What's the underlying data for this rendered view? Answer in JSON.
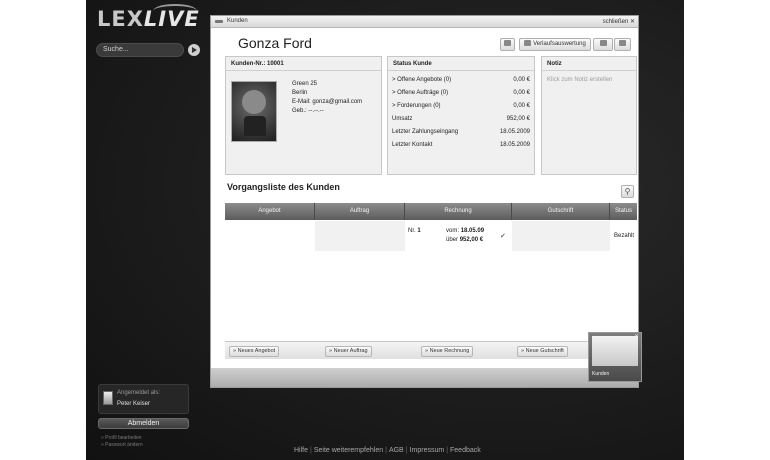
{
  "logo": {
    "prefix": "LEX",
    "suffix": "LIVE"
  },
  "sidebar": {
    "search_placeholder": "Suche...",
    "logged_in_label": "Angemeldet als:",
    "user_name": "Peter Keiser",
    "logout_label": "Abmelden",
    "links": [
      "Profil bearbeiten",
      "Passwort ändern"
    ]
  },
  "footer": {
    "links": [
      "Hilfe",
      "Seite weiterempfehlen",
      "AGB",
      "Impressum",
      "Feedback"
    ]
  },
  "window": {
    "title": "Kunden",
    "close_label": "schließen",
    "customer_name": "Gonza Ford",
    "toolbar": {
      "history_label": "Verlaufsauswertung"
    }
  },
  "customer": {
    "header": "Kunden-Nr.: 10001",
    "address": [
      "Green 25",
      "Berlin",
      "E-Mail: gonza@gmail.com",
      "Geb.: --.--.--"
    ]
  },
  "status": {
    "header": "Status Kunde",
    "rows": [
      {
        "label": "> Offene Angebote (0)",
        "value": "0,00 €"
      },
      {
        "label": "> Offene Aufträge (0)",
        "value": "0,00 €"
      },
      {
        "label": "> Forderungen (0)",
        "value": "0,00 €"
      },
      {
        "label": "Umsatz",
        "value": "952,00 €"
      },
      {
        "label": "Letzter Zahlungseingang",
        "value": "18.05.2009"
      },
      {
        "label": "Letzter Kontakt",
        "value": "18.05.2009"
      }
    ]
  },
  "note": {
    "header": "Notiz",
    "placeholder": "Klick zum Notiz erstellen"
  },
  "transactions": {
    "title": "Vorgangsliste des Kunden",
    "columns": [
      "Angebot",
      "Auftrag",
      "Rechnung",
      "Gutschrift",
      "Status"
    ],
    "row": {
      "nr_label": "Nr.",
      "nr_value": "1",
      "from_label": "vom:",
      "from_value": "18.05.09",
      "over_label": "über",
      "over_value": "952,00 €",
      "status": "Bezahlt"
    }
  },
  "actions": [
    "Neues Angebot",
    "Neuer Auftrag",
    "Neue Rechnung",
    "Neue Gutschrift"
  ],
  "minimized": {
    "label": "Kunden"
  }
}
